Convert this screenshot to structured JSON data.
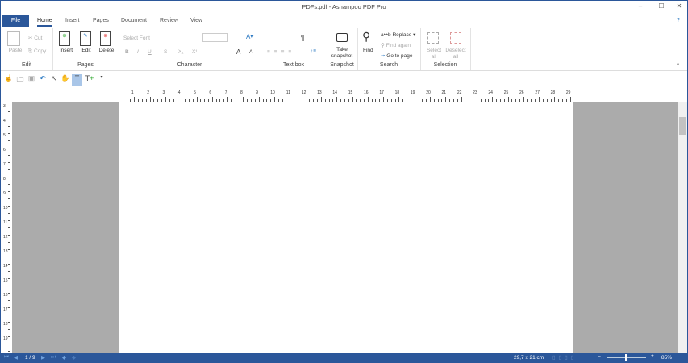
{
  "window": {
    "title": "PDFs.pdf - Ashampoo PDF Pro",
    "minimize": "–",
    "maximize": "☐",
    "close": "✕",
    "help": "?"
  },
  "tabs": [
    "File",
    "Home",
    "Insert",
    "Pages",
    "Document",
    "Review",
    "View"
  ],
  "ribbon": {
    "edit": {
      "label": "Edit",
      "paste": "Paste",
      "cut": "Cut",
      "copy": "Copy"
    },
    "pages": {
      "label": "Pages",
      "insert": "Insert",
      "edit": "Edit",
      "delete": "Delete"
    },
    "character": {
      "label": "Character",
      "font_placeholder": "Select Font",
      "bold": "B",
      "italic": "I",
      "underline": "U",
      "strike": "S",
      "sub": "X₁",
      "sup": "X¹",
      "grow": "A",
      "shrink": "A"
    },
    "textbox": {
      "label": "Text box",
      "pilcrow": "¶"
    },
    "snapshot": {
      "label": "Snapshot",
      "take": "Take snapshot"
    },
    "search": {
      "label": "Search",
      "find": "Find",
      "replace": "Replace",
      "find_again": "Find again",
      "go_to_page": "Go to page"
    },
    "selection": {
      "label": "Selection",
      "select_all": "Select all",
      "deselect_all": "Deselect all"
    }
  },
  "ruler": {
    "h": [
      "1",
      "2",
      "3",
      "4",
      "5",
      "6",
      "7",
      "8",
      "9",
      "10",
      "11",
      "12",
      "13",
      "14",
      "15",
      "16",
      "17",
      "18",
      "19",
      "20",
      "21",
      "22",
      "23",
      "24",
      "25",
      "26",
      "27",
      "28",
      "29"
    ],
    "v": [
      "3",
      "4",
      "5",
      "6",
      "7",
      "8",
      "9",
      "10",
      "11",
      "12",
      "13",
      "14",
      "15",
      "16",
      "17",
      "18",
      "19"
    ]
  },
  "status": {
    "page": "1 / 9",
    "size": "29,7 x 21 cm",
    "zoom": "85%",
    "zoom_fraction": 0.45
  }
}
